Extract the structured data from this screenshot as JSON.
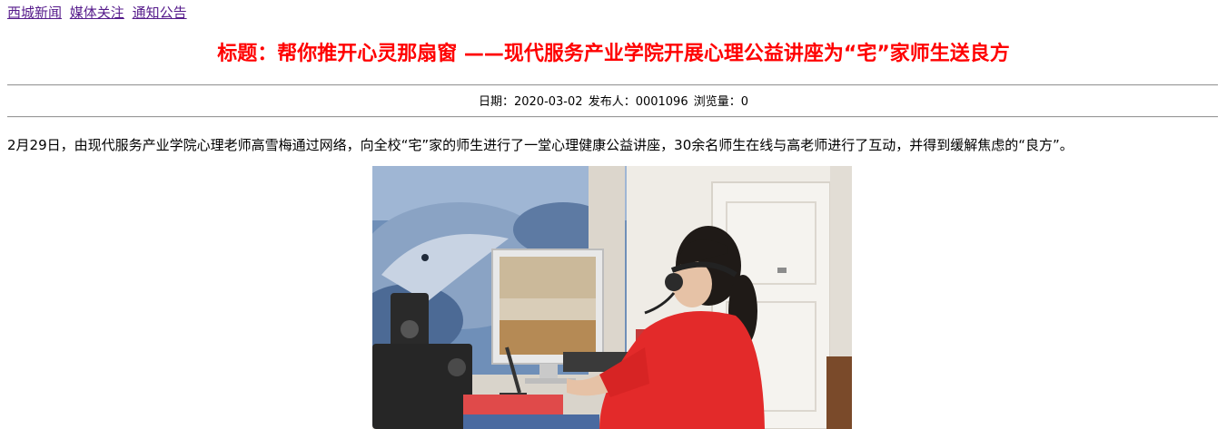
{
  "breadcrumb": [
    {
      "label": "西城新闻"
    },
    {
      "label": "媒体关注"
    },
    {
      "label": "通知公告"
    }
  ],
  "article": {
    "title": "标题：帮你推开心灵那扇窗 ——现代服务产业学院开展心理公益讲座为“宅”家师生送良方",
    "date_label": "日期：2020-03-02",
    "author_label": "发布人：0001096",
    "views_label": "浏览量：0",
    "paragraph": "2月29日，由现代服务产业学院心理老师高雪梅通过网络，向全校“宅”家的师生进行了一堂心理健康公益讲座，30余名师生在线与高老师进行了互动，并得到缓解焦虑的“良方”。"
  },
  "colors": {
    "title": "#ff0000",
    "link_visited": "#551a8b",
    "rule": "#9a9a9a"
  }
}
